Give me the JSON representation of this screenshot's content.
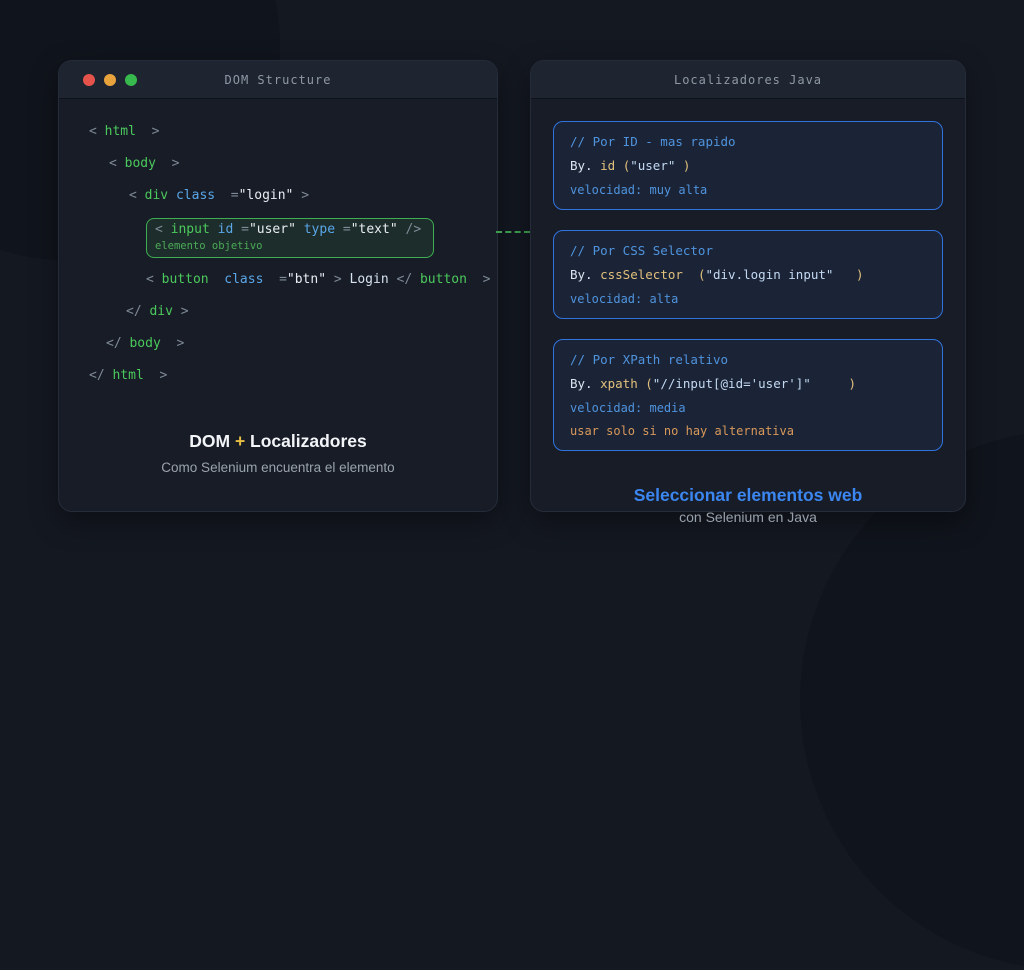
{
  "colors": {
    "highlight_green": "#3fae52",
    "card_border_blue": "#3173dd",
    "traffic_red": "#e5534b",
    "traffic_yellow": "#e8a33d",
    "traffic_green": "#37b94d",
    "footer_accent_blue": "#3b86f0",
    "warning_orange": "#d8995a"
  },
  "left_panel": {
    "title": "DOM Structure",
    "code_lines": [
      {
        "tokens": [
          {
            "t": "< ",
            "c": "punct"
          },
          {
            "t": "html",
            "c": "tag"
          },
          {
            "t": "  >",
            "c": "punct"
          }
        ]
      },
      {
        "tokens": [
          {
            "t": "< ",
            "c": "punct"
          },
          {
            "t": "body",
            "c": "tag"
          },
          {
            "t": "  >",
            "c": "punct"
          }
        ]
      },
      {
        "tokens": [
          {
            "t": "< ",
            "c": "punct"
          },
          {
            "t": "div ",
            "c": "tag"
          },
          {
            "t": "class",
            "c": "attr"
          },
          {
            "t": "  =",
            "c": "punct"
          },
          {
            "t": "\"login\"",
            "c": "string"
          },
          {
            "t": " >",
            "c": "punct"
          }
        ]
      },
      {
        "tokens": [
          {
            "t": "< ",
            "c": "punct"
          },
          {
            "t": "input ",
            "c": "tag"
          },
          {
            "t": "id",
            "c": "attr"
          },
          {
            "t": " =",
            "c": "punct"
          },
          {
            "t": "\"user\"",
            "c": "string"
          },
          {
            "t": " ",
            "c": "punct"
          },
          {
            "t": "type",
            "c": "attr"
          },
          {
            "t": " =",
            "c": "punct"
          },
          {
            "t": "\"text\"",
            "c": "string"
          },
          {
            "t": " />",
            "c": "punct"
          }
        ]
      },
      {
        "tokens": [
          {
            "t": "< ",
            "c": "punct"
          },
          {
            "t": "button ",
            "c": "tag"
          },
          {
            "t": " ",
            "c": "punct"
          },
          {
            "t": "class",
            "c": "attr"
          },
          {
            "t": "  =",
            "c": "punct"
          },
          {
            "t": "\"btn\"",
            "c": "string"
          },
          {
            "t": " > ",
            "c": "punct"
          },
          {
            "t": "Login",
            "c": "text"
          },
          {
            "t": " </ ",
            "c": "punct"
          },
          {
            "t": "button",
            "c": "tag"
          },
          {
            "t": "  >",
            "c": "punct"
          }
        ]
      },
      {
        "tokens": [
          {
            "t": "</ ",
            "c": "punct"
          },
          {
            "t": "div",
            "c": "tag"
          },
          {
            "t": " >",
            "c": "punct"
          }
        ]
      },
      {
        "tokens": [
          {
            "t": "</ ",
            "c": "punct"
          },
          {
            "t": "body",
            "c": "tag"
          },
          {
            "t": "  >",
            "c": "punct"
          }
        ]
      },
      {
        "tokens": [
          {
            "t": "</ ",
            "c": "punct"
          },
          {
            "t": "html",
            "c": "tag"
          },
          {
            "t": "  >",
            "c": "punct"
          }
        ]
      }
    ],
    "highlight_label": "elemento objetivo",
    "footer_title_tokens": [
      {
        "t": "DOM ",
        "c": "white"
      },
      {
        "t": "+",
        "c": "plus"
      },
      {
        "t": " Localizadores",
        "c": "white"
      }
    ],
    "footer_subtitle": "Como Selenium encuentra el elemento"
  },
  "right_panel": {
    "title": "Localizadores Java",
    "cards": [
      {
        "comment": "// Por ID - mas rapido",
        "code_tokens": [
          {
            "t": "By. ",
            "c": "plain"
          },
          {
            "t": "id ",
            "c": "method"
          },
          {
            "t": "(",
            "c": "method"
          },
          {
            "t": "\"user\"",
            "c": "strblue"
          },
          {
            "t": " )",
            "c": "method"
          }
        ],
        "meta": "velocidad: muy alta"
      },
      {
        "comment": "// Por CSS Selector",
        "code_tokens": [
          {
            "t": "By. ",
            "c": "plain"
          },
          {
            "t": "cssSelector  ",
            "c": "method"
          },
          {
            "t": "(",
            "c": "method"
          },
          {
            "t": "\"div.login input\"",
            "c": "strblue"
          },
          {
            "t": "   )",
            "c": "method"
          }
        ],
        "meta": "velocidad: alta"
      },
      {
        "comment": "// Por XPath relativo",
        "code_tokens": [
          {
            "t": "By. ",
            "c": "plain"
          },
          {
            "t": "xpath ",
            "c": "method"
          },
          {
            "t": "(",
            "c": "method"
          },
          {
            "t": "\"//input[@id='user']\"",
            "c": "strblue"
          },
          {
            "t": "     )",
            "c": "method"
          }
        ],
        "meta": "velocidad: media",
        "warning": "usar solo si no hay alternativa"
      }
    ],
    "footer_title": "Seleccionar elementos web",
    "footer_subtitle": "con Selenium en Java"
  }
}
